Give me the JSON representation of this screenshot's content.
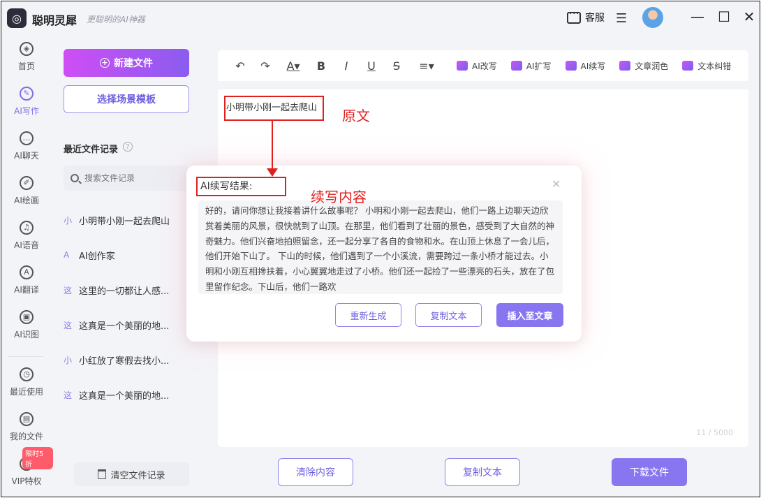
{
  "app": {
    "logo_glyph": "◎",
    "name": "聪明灵犀",
    "slogan": "更聪明的AI神器",
    "service_label": "客服"
  },
  "window_controls": {
    "minimize": "—",
    "maximize": "☐",
    "close": "✕"
  },
  "leftnav": {
    "items": [
      {
        "glyph": "◈",
        "label": "首页"
      },
      {
        "glyph": "✎",
        "label": "AI写作",
        "active": true
      },
      {
        "glyph": "…",
        "label": "AI聊天"
      },
      {
        "glyph": "✐",
        "label": "AI绘画"
      },
      {
        "glyph": "♫",
        "label": "AI语音"
      },
      {
        "glyph": "A",
        "label": "AI翻译"
      },
      {
        "glyph": "▣",
        "label": "AI识图"
      },
      {
        "glyph": "◷",
        "label": "最近使用"
      },
      {
        "glyph": "▤",
        "label": "我的文件"
      },
      {
        "glyph": "♢",
        "label": "VIP特权"
      }
    ],
    "vip_badge": "限时5折"
  },
  "filepanel": {
    "new_file_label": "新建文件",
    "template_label": "选择场景模板",
    "recent_title": "最近文件记录",
    "help_glyph": "?",
    "search_placeholder": "搜索文件记录",
    "recent_items": [
      {
        "mark": "小",
        "title": "小明带小刚一起去爬山"
      },
      {
        "mark": "A",
        "title": "AI创作家"
      },
      {
        "mark": "这",
        "title": "这里的一切都让人感..."
      },
      {
        "mark": "这",
        "title": "这真是一个美丽的地..."
      },
      {
        "mark": "小",
        "title": "小红放了寒假去找小..."
      },
      {
        "mark": "这",
        "title": "这真是一个美丽的地..."
      }
    ],
    "clear_label": "清空文件记录"
  },
  "toolbar": {
    "undo": "↶",
    "redo": "↷",
    "font_color": "A▾",
    "bold": "B",
    "italic": "I",
    "underline": "U",
    "strike": "S",
    "align": "≡▾",
    "ai_tools": [
      "AI改写",
      "AI扩写",
      "AI续写",
      "文章润色",
      "文本纠错"
    ]
  },
  "editor": {
    "content": "小明带小刚一起去爬山",
    "word_count": "11 / 5000"
  },
  "annotations": {
    "original_label": "原文",
    "continuation_label": "续写内容"
  },
  "dialog": {
    "title": "AI续写结果:",
    "close": "✕",
    "result_text": "好的，请问你想让我接着讲什么故事呢？ 小明和小刚一起去爬山，他们一路上边聊天边欣赏着美丽的风景，很快就到了山顶。在那里，他们看到了壮丽的景色，感受到了大自然的神奇魅力。他们兴奋地拍照留念，还一起分享了各自的食物和水。在山顶上休息了一会儿后，他们开始下山了。 下山的时候，他们遇到了一个小溪流，需要跨过一条小桥才能过去。小明和小刚互相搀扶着，小心翼翼地走过了小桥。他们还一起捡了一些漂亮的石头，放在了包里留作纪念。下山后，他们一路欢",
    "regenerate": "重新生成",
    "copy": "复制文本",
    "insert": "插入至文章"
  },
  "bottom": {
    "clear": "清除内容",
    "copy": "复制文本",
    "download": "下载文件"
  }
}
